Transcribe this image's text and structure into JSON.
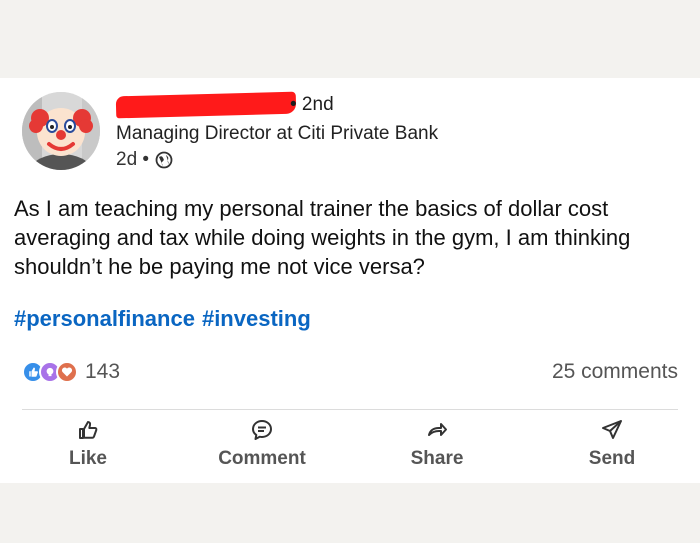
{
  "post": {
    "author": {
      "degree": "• 2nd",
      "headline": "Managing Director at Citi Private Bank",
      "time": "2d •",
      "visibility_icon": "globe-icon"
    },
    "text": "As I am teaching my personal trainer the basics of dollar cost averaging and tax while doing weights in the gym, I am thinking shouldn’t he be paying me not vice versa?",
    "hashtags": [
      "#personalfinance",
      "#investing"
    ],
    "social": {
      "reaction_icons": [
        "like-icon",
        "insightful-icon",
        "love-icon"
      ],
      "reaction_count": "143",
      "comments": "25 comments"
    },
    "actions": {
      "like": "Like",
      "comment": "Comment",
      "share": "Share",
      "send": "Send"
    }
  },
  "colors": {
    "hashtag": "#0a66c2",
    "redaction": "#ff1a1a",
    "background": "#f3f2ef"
  }
}
